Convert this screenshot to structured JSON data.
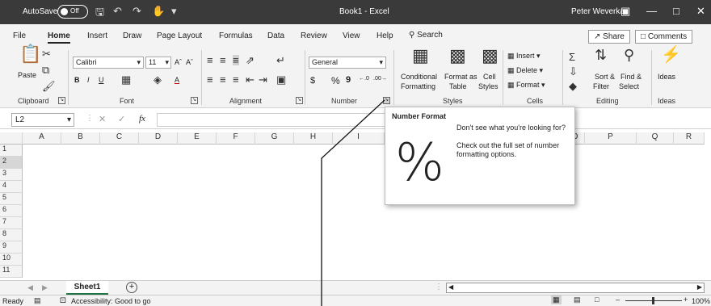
{
  "titlebar": {
    "autosave_label": "AutoSave",
    "autosave_state": "Off",
    "document_title": "Book1 - Excel",
    "user_name": "Peter Weverka",
    "minimize": "—",
    "maximize": "□",
    "close": "✕"
  },
  "menu": {
    "tabs": [
      "File",
      "Home",
      "Insert",
      "Draw",
      "Page Layout",
      "Formulas",
      "Data",
      "Review",
      "View",
      "Help"
    ],
    "active_tab": "Home",
    "search_label": "Search",
    "share_label": "Share",
    "comments_label": "Comments"
  },
  "ribbon": {
    "clipboard": {
      "paste_label": "Paste",
      "group_label": "Clipboard"
    },
    "font": {
      "font_name": "Calibri",
      "font_size": "11",
      "group_label": "Font",
      "bold": "B",
      "italic": "I",
      "underline": "U"
    },
    "alignment": {
      "group_label": "Alignment"
    },
    "number": {
      "format_value": "General",
      "currency": "$",
      "percent": "%",
      "comma": "9",
      "group_label": "Number"
    },
    "styles": {
      "conditional_formatting": [
        "Conditional",
        "Formatting"
      ],
      "format_as_table": [
        "Format as",
        "Table"
      ],
      "cell_styles": [
        "Cell",
        "Styles"
      ],
      "group_label": "Styles"
    },
    "cells": {
      "insert": "Insert",
      "delete": "Delete",
      "format": "Format",
      "group_label": "Cells"
    },
    "editing": {
      "sort_filter": [
        "Sort &",
        "Filter"
      ],
      "find_select": [
        "Find &",
        "Select"
      ],
      "group_label": "Editing"
    },
    "ideas": {
      "label": "Ideas",
      "group_label": "Ideas"
    }
  },
  "formula_bar": {
    "name_box": "L2",
    "fx": "fx",
    "cancel": "✕",
    "enter": "✓"
  },
  "columns": [
    "A",
    "B",
    "C",
    "D",
    "E",
    "F",
    "G",
    "H",
    "I",
    "O",
    "P",
    "Q",
    "R"
  ],
  "rows": [
    "1",
    "2",
    "3",
    "4",
    "5",
    "6",
    "7",
    "8",
    "9",
    "10",
    "11"
  ],
  "selected_row": "2",
  "sheet": {
    "tab_name": "Sheet1",
    "add_label": "+"
  },
  "status": {
    "ready": "Ready",
    "accessibility": "Accessibility: Good to go",
    "zoom": "100%"
  },
  "popup": {
    "title": "Number Format",
    "line1": "Don't see what you're looking for?",
    "line2": "Check out the full set of number formatting options.",
    "symbol": "%"
  }
}
